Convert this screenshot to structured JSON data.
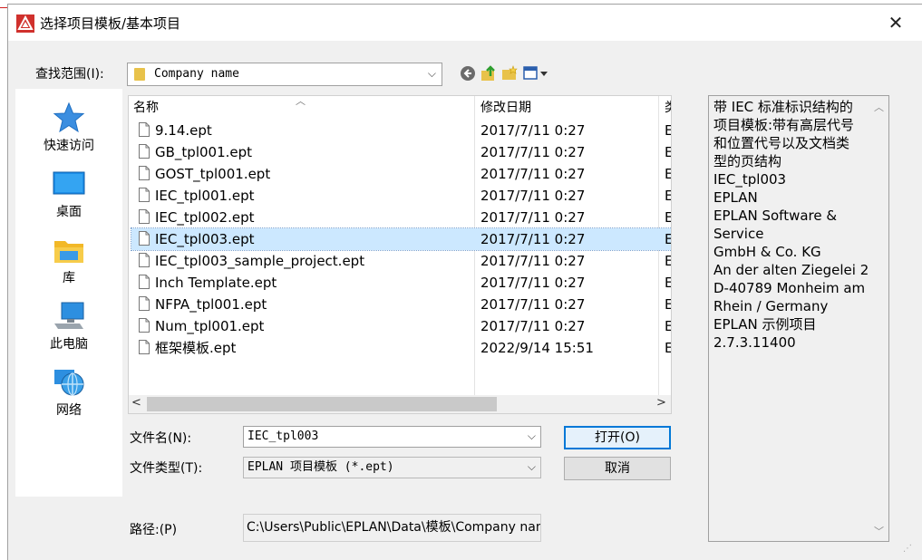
{
  "dialog": {
    "title": "选择项目模板/基本项目",
    "close_glyph": "✕"
  },
  "lookin": {
    "label": "查找范围(I):",
    "value": "Company name"
  },
  "places": [
    {
      "label": "快速访问",
      "icon": "star-icon"
    },
    {
      "label": "桌面",
      "icon": "desktop-icon"
    },
    {
      "label": "库",
      "icon": "library-folder-icon"
    },
    {
      "label": "此电脑",
      "icon": "computer-icon"
    },
    {
      "label": "网络",
      "icon": "network-globe-icon"
    }
  ],
  "filelist": {
    "columns": {
      "name": "名称",
      "date": "修改日期",
      "type": "类"
    },
    "rows": [
      {
        "name": "9.14.ept",
        "date": "2017/7/11 0:27",
        "type": "E"
      },
      {
        "name": "GB_tpl001.ept",
        "date": "2017/7/11 0:27",
        "type": "E"
      },
      {
        "name": "GOST_tpl001.ept",
        "date": "2017/7/11 0:27",
        "type": "E"
      },
      {
        "name": "IEC_tpl001.ept",
        "date": "2017/7/11 0:27",
        "type": "E"
      },
      {
        "name": "IEC_tpl002.ept",
        "date": "2017/7/11 0:27",
        "type": "E"
      },
      {
        "name": "IEC_tpl003.ept",
        "date": "2017/7/11 0:27",
        "type": "E",
        "selected": true
      },
      {
        "name": "IEC_tpl003_sample_project.ept",
        "date": "2017/7/11 0:27",
        "type": "E"
      },
      {
        "name": "Inch Template.ept",
        "date": "2017/7/11 0:27",
        "type": "E"
      },
      {
        "name": "NFPA_tpl001.ept",
        "date": "2017/7/11 0:27",
        "type": "E"
      },
      {
        "name": "Num_tpl001.ept",
        "date": "2017/7/11 0:27",
        "type": "E"
      },
      {
        "name": "框架模板.ept",
        "date": "2022/9/14 15:51",
        "type": "E"
      }
    ]
  },
  "filename": {
    "label": "文件名(N):",
    "value": "IEC_tpl003"
  },
  "filetype": {
    "label": "文件类型(T):",
    "value": "EPLAN 项目模板 (*.ept)"
  },
  "buttons": {
    "open": "打开(O)",
    "cancel": "取消"
  },
  "path": {
    "label": "路径:(P)",
    "value": "C:\\Users\\Public\\EPLAN\\Data\\模板\\Company name"
  },
  "description": [
    "带 IEC 标准标识结构的",
    "项目模板:带有高层代号",
    "和位置代号以及文档类",
    "型的页结构",
    "IEC_tpl003",
    "EPLAN",
    "EPLAN Software &",
    "Service",
    "GmbH & Co. KG",
    "An der alten Ziegelei 2",
    "D-40789 Monheim am",
    "Rhein / Germany",
    "EPLAN 示例项目",
    "2.7.3.11400"
  ],
  "colors": {
    "selection": "#cce8ff",
    "accent": "#0078d7",
    "logo_red": "#d0312d"
  }
}
